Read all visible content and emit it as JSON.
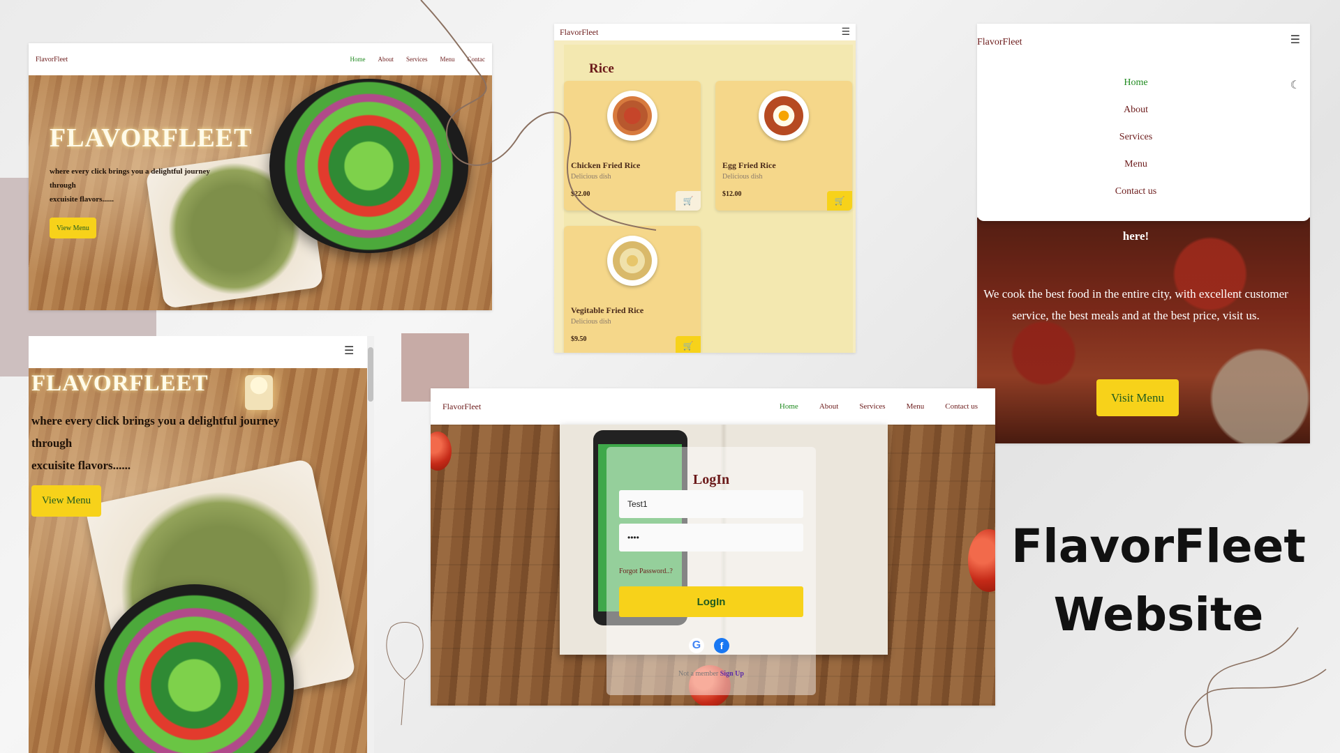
{
  "brand": "FlavorFleet",
  "nav": {
    "home": "Home",
    "about": "About",
    "services": "Services",
    "menu": "Menu",
    "contact": "Contact us",
    "contact_truncated": "Contac"
  },
  "hero": {
    "title": "FLAVORFLEET",
    "line1": "where every click brings you a delightful journey",
    "line2": "through",
    "line3": "excuisite flavors......",
    "button": "View Menu"
  },
  "rice_menu": {
    "section_title": "Rice",
    "items": [
      {
        "name": "Chicken Fried Rice",
        "desc": "Delicious dish",
        "price": "$22.00"
      },
      {
        "name": "Egg Fried Rice",
        "desc": "Delicious dish",
        "price": "$12.00"
      },
      {
        "name": "Vegitable Fried Rice",
        "desc": "Delicious dish",
        "price": "$9.50"
      }
    ]
  },
  "mobile_nav": {
    "here_text": "here!",
    "tagline": "We cook the best food in the entire city, with excellent customer service, the best meals and at the best price, visit us.",
    "button": "Visit Menu"
  },
  "login": {
    "title": "LogIn",
    "username_value": "Test1",
    "password_value": "••••",
    "forgot": "Forgot Password..?",
    "button": "LogIn",
    "not_member": "Not a member",
    "sign_up": "Sign Up"
  },
  "page_title": {
    "line1": "FlavorFleet",
    "line2": "Website"
  },
  "icons": {
    "menu": "hamburger-icon",
    "cart": "cart-icon",
    "theme": "moon-icon",
    "google": "google-icon",
    "facebook": "facebook-icon"
  },
  "colors": {
    "brand_maroon": "#6b1a1a",
    "active_green": "#1f8a1f",
    "accent_yellow": "#f7d21a",
    "card_bg": "#f5d78a"
  }
}
